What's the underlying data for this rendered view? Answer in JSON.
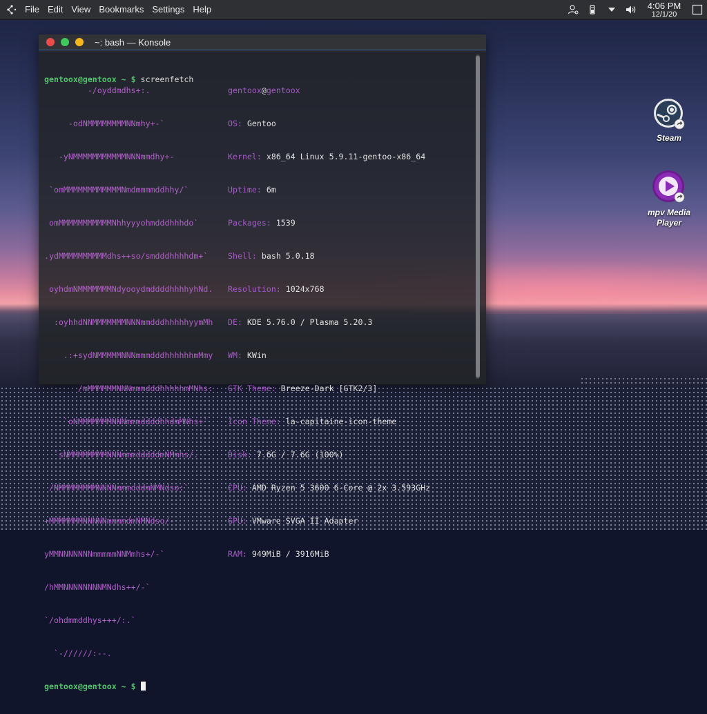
{
  "menubar": {
    "items": [
      "File",
      "Edit",
      "View",
      "Bookmarks",
      "Settings",
      "Help"
    ],
    "clock_time": "4:06 PM",
    "clock_date": "12/1/20"
  },
  "window": {
    "title": "~: bash — Konsole"
  },
  "terminal": {
    "prompt_user": "gentoox@gentoox ~ $",
    "command": "screenfetch",
    "art_lines": [
      "         -/oyddmdhs+:.",
      "     -odNMMMMMMMMNNmhy+-`",
      "   -yNMMMMMMMMMMMNNNmmdhy+-",
      " `omMMMMMMMMMMMMNmdmmmmddhhy/`",
      " omMMMMMMMMMMMNhhyyyohmdddhhhdo`",
      ".ydMMMMMMMMMMdhs++so/smdddhhhhdm+`",
      " oyhdmNMMMMMMMNdyooydmddddhhhhyhNd.",
      "  :oyhhdNNMMMMMMMNNNmmdddhhhhhyymMh",
      "    .:+sydNMMMMMNNNmmmdddhhhhhhmMmy",
      "       /mMMMMMMNNNmmmdddhhhhhmMNhs:",
      "    `oNMMMMMMMNNNmmmddddhhdmMNhs+`",
      "  `sNMMMMMMMMNNNmmmdddddmNMmhs/.",
      " /NMMMMMMMMNNNNmmmdddmNMNdso:`",
      "+MMMMMMMNNNNNmmmmdmNMNdso/-",
      "yMMNNNNNNNmmmmmNNMmhs+/-`",
      "/hMMNNNNNNNNMNdhs++/-`",
      "`/ohdmmddhys+++/:.`",
      "  `-//////:--."
    ],
    "info_header_user": "gentoox",
    "info_header_at": "@",
    "info_header_host": "gentoox",
    "info": [
      {
        "key": "OS:",
        "value": "Gentoo"
      },
      {
        "key": "Kernel:",
        "value": "x86_64 Linux 5.9.11-gentoo-x86_64"
      },
      {
        "key": "Uptime:",
        "value": "6m"
      },
      {
        "key": "Packages:",
        "value": "1539"
      },
      {
        "key": "Shell:",
        "value": "bash 5.0.18"
      },
      {
        "key": "Resolution:",
        "value": "1024x768"
      },
      {
        "key": "DE:",
        "value": "KDE 5.76.0 / Plasma 5.20.3"
      },
      {
        "key": "WM:",
        "value": "KWin"
      },
      {
        "key": "GTK Theme:",
        "value": "Breeze-Dark [GTK2/3]"
      },
      {
        "key": "Icon Theme:",
        "value": "la-capitaine-icon-theme"
      },
      {
        "key": "Disk:",
        "value": "7.6G / 7.6G (100%)"
      },
      {
        "key": "CPU:",
        "value": "AMD Ryzen 5 3600 6-Core @ 2x 3.593GHz"
      },
      {
        "key": "GPU:",
        "value": "VMware SVGA II Adapter"
      },
      {
        "key": "RAM:",
        "value": "949MiB / 3916MiB"
      }
    ]
  },
  "desktop": {
    "icons": [
      {
        "label": "Steam",
        "icon": "steam-icon"
      },
      {
        "label": "mpv Media Player",
        "icon": "mpv-icon"
      }
    ]
  },
  "colors": {
    "prompt": "#53c46b",
    "key": "#a55bc7",
    "mpv_accent": "#8a2bb5"
  }
}
